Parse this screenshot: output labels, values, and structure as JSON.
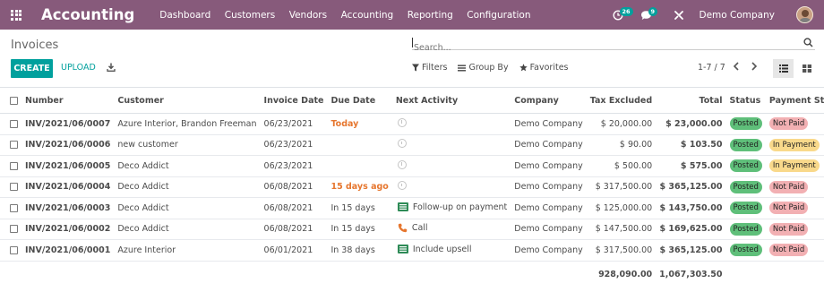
{
  "app": {
    "name": "Accounting",
    "menu": [
      "Dashboard",
      "Customers",
      "Vendors",
      "Accounting",
      "Reporting",
      "Configuration"
    ],
    "activity_badge": "26",
    "chat_badge": "9",
    "company": "Demo Company"
  },
  "control_panel": {
    "title": "Invoices",
    "search_placeholder": "Search...",
    "create_label": "CREATE",
    "upload_label": "UPLOAD",
    "filters_label": "Filters",
    "groupby_label": "Group By",
    "favorites_label": "Favorites",
    "pager": "1-7 / 7"
  },
  "table": {
    "columns": [
      "Number",
      "Customer",
      "Invoice Date",
      "Due Date",
      "Next Activity",
      "Company",
      "Tax Excluded",
      "Total",
      "Status",
      "Payment Status"
    ],
    "rows": [
      {
        "number": "INV/2021/06/0007",
        "customer": "Azure Interior, Brandon Freeman",
        "invoice_date": "06/23/2021",
        "due_date": "Today",
        "due_style": "today",
        "activity_icon": "clock-icon",
        "activity": "",
        "company": "Demo Company",
        "tax_excluded": "$ 20,000.00",
        "total": "$ 23,000.00",
        "status": "Posted",
        "payment_status": "Not Paid",
        "pay_style": "notpaid"
      },
      {
        "number": "INV/2021/06/0006",
        "customer": "new customer",
        "invoice_date": "06/23/2021",
        "due_date": "",
        "due_style": "",
        "activity_icon": "clock-icon",
        "activity": "",
        "company": "Demo Company",
        "tax_excluded": "$ 90.00",
        "total": "$ 103.50",
        "status": "Posted",
        "payment_status": "In Payment",
        "pay_style": "inpay"
      },
      {
        "number": "INV/2021/06/0005",
        "customer": "Deco Addict",
        "invoice_date": "06/23/2021",
        "due_date": "",
        "due_style": "",
        "activity_icon": "clock-icon",
        "activity": "",
        "company": "Demo Company",
        "tax_excluded": "$ 500.00",
        "total": "$ 575.00",
        "status": "Posted",
        "payment_status": "In Payment",
        "pay_style": "inpay"
      },
      {
        "number": "INV/2021/06/0004",
        "customer": "Deco Addict",
        "invoice_date": "06/08/2021",
        "due_date": "15 days ago",
        "due_style": "late",
        "activity_icon": "clock-icon",
        "activity": "",
        "company": "Demo Company",
        "tax_excluded": "$ 317,500.00",
        "total": "$ 365,125.00",
        "status": "Posted",
        "payment_status": "Not Paid",
        "pay_style": "notpaid"
      },
      {
        "number": "INV/2021/06/0003",
        "customer": "Deco Addict",
        "invoice_date": "06/08/2021",
        "due_date": "In 15 days",
        "due_style": "",
        "activity_icon": "task-list-icon",
        "activity": "Follow-up on payment",
        "company": "Demo Company",
        "tax_excluded": "$ 125,000.00",
        "total": "$ 143,750.00",
        "status": "Posted",
        "payment_status": "Not Paid",
        "pay_style": "notpaid"
      },
      {
        "number": "INV/2021/06/0002",
        "customer": "Deco Addict",
        "invoice_date": "06/08/2021",
        "due_date": "In 15 days",
        "due_style": "",
        "activity_icon": "phone-icon",
        "activity": "Call",
        "company": "Demo Company",
        "tax_excluded": "$ 147,500.00",
        "total": "$ 169,625.00",
        "status": "Posted",
        "payment_status": "Not Paid",
        "pay_style": "notpaid"
      },
      {
        "number": "INV/2021/06/0001",
        "customer": "Azure Interior",
        "invoice_date": "06/01/2021",
        "due_date": "In 38 days",
        "due_style": "",
        "activity_icon": "task-list-icon",
        "activity": "Include upsell",
        "company": "Demo Company",
        "tax_excluded": "$ 317,500.00",
        "total": "$ 365,125.00",
        "status": "Posted",
        "payment_status": "Not Paid",
        "pay_style": "notpaid"
      }
    ],
    "footer": {
      "tax_excluded": "928,090.00",
      "total": "1,067,303.50"
    }
  },
  "colors": {
    "topbar": "#875a7b",
    "accent": "#00a09d",
    "posted": "#5fbf7a",
    "not_paid": "#f2b0b3",
    "in_payment": "#f9d98b",
    "due_warning": "#e6762e"
  }
}
